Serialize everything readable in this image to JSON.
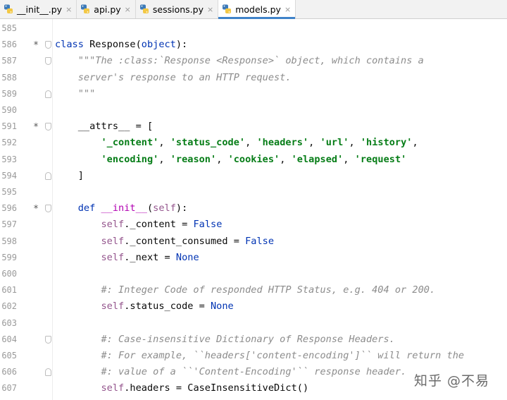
{
  "tabs": [
    {
      "label": "__init__.py",
      "active": false,
      "close": "×"
    },
    {
      "label": "api.py",
      "active": false,
      "close": "×"
    },
    {
      "label": "sessions.py",
      "active": false,
      "close": "×"
    },
    {
      "label": "models.py",
      "active": true,
      "close": "×"
    }
  ],
  "colors": {
    "keyword": "#0033b3",
    "string": "#067d17",
    "comment": "#8c8c8c",
    "self": "#94558d",
    "dunder": "#b200b2",
    "active_tab_underline": "#4083c9"
  },
  "editor": {
    "lines": [
      {
        "num": "585",
        "segments": []
      },
      {
        "num": "586",
        "mark": "*",
        "fold": "open",
        "segments": [
          {
            "t": "class",
            "c": "kw"
          },
          {
            "t": " Response(",
            "c": "plain"
          },
          {
            "t": "object",
            "c": "kw"
          },
          {
            "t": "):",
            "c": "plain"
          }
        ]
      },
      {
        "num": "587",
        "fold": "open",
        "segments": [
          {
            "t": "    \"\"\"The :class:`Response <Response>` object, which contains a",
            "c": "doc"
          }
        ]
      },
      {
        "num": "588",
        "segments": [
          {
            "t": "    server's response to an HTTP request.",
            "c": "doc"
          }
        ]
      },
      {
        "num": "589",
        "fold": "close",
        "segments": [
          {
            "t": "    \"\"\"",
            "c": "doc"
          }
        ]
      },
      {
        "num": "590",
        "segments": []
      },
      {
        "num": "591",
        "mark": "*",
        "fold": "open",
        "segments": [
          {
            "t": "    __attrs__",
            "c": "plain"
          },
          {
            "t": " = [",
            "c": "plain"
          }
        ]
      },
      {
        "num": "592",
        "segments": [
          {
            "t": "        ",
            "c": "plain"
          },
          {
            "t": "'_content'",
            "c": "str"
          },
          {
            "t": ", ",
            "c": "plain"
          },
          {
            "t": "'status_code'",
            "c": "str"
          },
          {
            "t": ", ",
            "c": "plain"
          },
          {
            "t": "'headers'",
            "c": "str"
          },
          {
            "t": ", ",
            "c": "plain"
          },
          {
            "t": "'url'",
            "c": "str"
          },
          {
            "t": ", ",
            "c": "plain"
          },
          {
            "t": "'history'",
            "c": "str"
          },
          {
            "t": ",",
            "c": "plain"
          }
        ]
      },
      {
        "num": "593",
        "segments": [
          {
            "t": "        ",
            "c": "plain"
          },
          {
            "t": "'encoding'",
            "c": "str"
          },
          {
            "t": ", ",
            "c": "plain"
          },
          {
            "t": "'reason'",
            "c": "str"
          },
          {
            "t": ", ",
            "c": "plain"
          },
          {
            "t": "'cookies'",
            "c": "str"
          },
          {
            "t": ", ",
            "c": "plain"
          },
          {
            "t": "'elapsed'",
            "c": "str"
          },
          {
            "t": ", ",
            "c": "plain"
          },
          {
            "t": "'request'",
            "c": "str"
          }
        ]
      },
      {
        "num": "594",
        "fold": "close",
        "segments": [
          {
            "t": "    ]",
            "c": "plain"
          }
        ]
      },
      {
        "num": "595",
        "segments": []
      },
      {
        "num": "596",
        "mark": "*",
        "fold": "open",
        "segments": [
          {
            "t": "    ",
            "c": "plain"
          },
          {
            "t": "def",
            "c": "kw"
          },
          {
            "t": " ",
            "c": "plain"
          },
          {
            "t": "__init__",
            "c": "dund"
          },
          {
            "t": "(",
            "c": "plain"
          },
          {
            "t": "self",
            "c": "self"
          },
          {
            "t": "):",
            "c": "plain"
          }
        ]
      },
      {
        "num": "597",
        "segments": [
          {
            "t": "        ",
            "c": "plain"
          },
          {
            "t": "self",
            "c": "self"
          },
          {
            "t": "._content = ",
            "c": "plain"
          },
          {
            "t": "False",
            "c": "const"
          }
        ]
      },
      {
        "num": "598",
        "segments": [
          {
            "t": "        ",
            "c": "plain"
          },
          {
            "t": "self",
            "c": "self"
          },
          {
            "t": "._content_consumed = ",
            "c": "plain"
          },
          {
            "t": "False",
            "c": "const"
          }
        ]
      },
      {
        "num": "599",
        "segments": [
          {
            "t": "        ",
            "c": "plain"
          },
          {
            "t": "self",
            "c": "self"
          },
          {
            "t": "._next = ",
            "c": "plain"
          },
          {
            "t": "None",
            "c": "const"
          }
        ]
      },
      {
        "num": "600",
        "segments": []
      },
      {
        "num": "601",
        "segments": [
          {
            "t": "        #: Integer Code of responded HTTP Status, e.g. 404 or 200.",
            "c": "cmt"
          }
        ]
      },
      {
        "num": "602",
        "segments": [
          {
            "t": "        ",
            "c": "plain"
          },
          {
            "t": "self",
            "c": "self"
          },
          {
            "t": ".status_code = ",
            "c": "plain"
          },
          {
            "t": "None",
            "c": "const"
          }
        ]
      },
      {
        "num": "603",
        "segments": []
      },
      {
        "num": "604",
        "fold": "open",
        "segments": [
          {
            "t": "        #: Case-insensitive Dictionary of Response Headers.",
            "c": "cmt"
          }
        ]
      },
      {
        "num": "605",
        "segments": [
          {
            "t": "        #: For example, ``headers['content-encoding']`` will return the",
            "c": "cmt"
          }
        ]
      },
      {
        "num": "606",
        "fold": "close",
        "segments": [
          {
            "t": "        #: value of a ``'Content-Encoding'`` response header.",
            "c": "cmt"
          }
        ]
      },
      {
        "num": "607",
        "segments": [
          {
            "t": "        ",
            "c": "plain"
          },
          {
            "t": "self",
            "c": "self"
          },
          {
            "t": ".headers = CaseInsensitiveDict()",
            "c": "plain"
          }
        ]
      }
    ]
  },
  "watermark": "知乎 @不易"
}
